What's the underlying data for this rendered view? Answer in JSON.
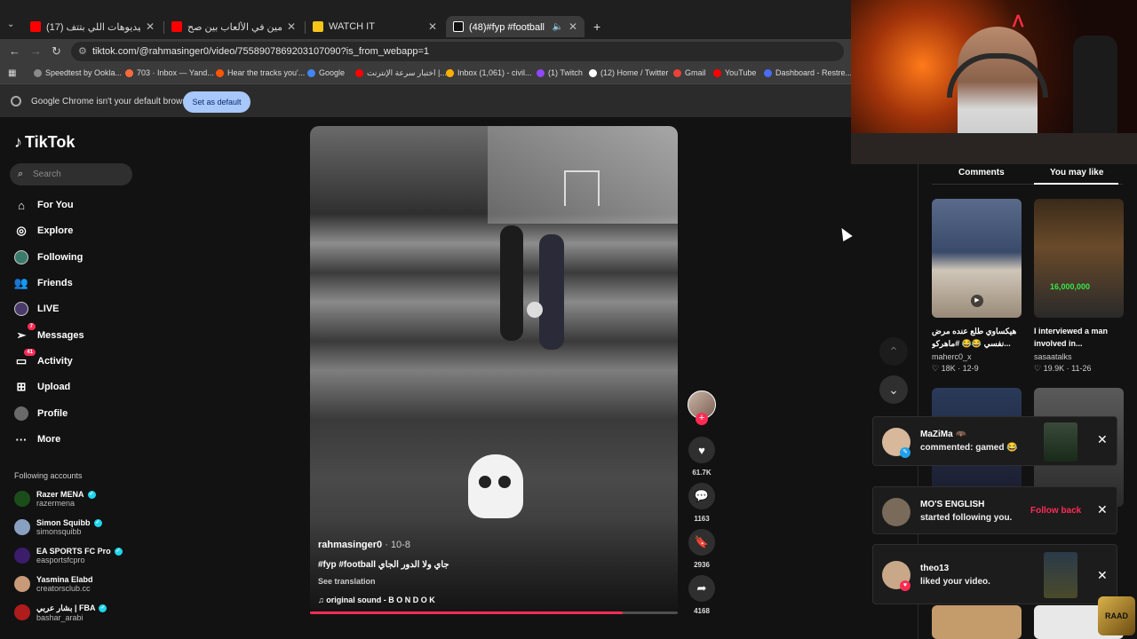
{
  "browser": {
    "tabs": [
      {
        "title": "(17) هي دي الفيديوهات اللي بتتف...",
        "icon": "youtube-icon",
        "color": "#ff0000",
        "active": false
      },
      {
        "title": "تحدي التخمين في الألعاب بين صح...",
        "icon": "youtube-icon",
        "color": "#ff0000",
        "active": false
      },
      {
        "title": "WATCH IT",
        "icon": "watchit-icon",
        "color": "#f5c518",
        "active": false
      },
      {
        "title": "(48)#fyp #football جاي ولا الدور الجاي",
        "icon": "tiktok-icon",
        "color": "#ffffff",
        "active": true
      }
    ],
    "new_tab": "+",
    "url": "tiktok.com/@rahmasinger0/video/7558907869203107090?is_from_webapp=1",
    "bookmarks": [
      {
        "label": "Speedtest by Ookla...",
        "color": "#8a8a8a"
      },
      {
        "label": "703 · Inbox — Yand...",
        "color": "#ff6a3d"
      },
      {
        "label": "Hear the tracks you'...",
        "color": "#ff5500"
      },
      {
        "label": "Google",
        "color": "#4285f4"
      },
      {
        "label": "اختبار سرعة الإنترنت |...",
        "color": "#ff0000"
      },
      {
        "label": "Inbox (1,061) - civil...",
        "color": "#ffb000"
      },
      {
        "label": "(1) Twitch",
        "color": "#9146ff"
      },
      {
        "label": "(12) Home / Twitter",
        "color": "#ffffff"
      },
      {
        "label": "Gmail",
        "color": "#ea4335"
      },
      {
        "label": "YouTube",
        "color": "#ff0000"
      },
      {
        "label": "Dashboard - Restre...",
        "color": "#4a6cf7"
      }
    ],
    "infobar": {
      "message": "Google Chrome isn't your default browser",
      "button": "Set as default"
    }
  },
  "tiktok": {
    "logo": "TikTok",
    "search_placeholder": "Search",
    "nav": [
      {
        "label": "For You",
        "icon": "home-icon"
      },
      {
        "label": "Explore",
        "icon": "compass-icon"
      },
      {
        "label": "Following",
        "icon": "following-avatar-icon"
      },
      {
        "label": "Friends",
        "icon": "friends-icon"
      },
      {
        "label": "LIVE",
        "icon": "live-icon"
      },
      {
        "label": "Messages",
        "icon": "messages-icon",
        "badge": "7"
      },
      {
        "label": "Activity",
        "icon": "activity-icon",
        "badge": "41"
      },
      {
        "label": "Upload",
        "icon": "upload-icon"
      },
      {
        "label": "Profile",
        "icon": "profile-avatar-icon"
      },
      {
        "label": "More",
        "icon": "more-icon"
      }
    ],
    "following_header": "Following accounts",
    "following": [
      {
        "name": "Razer MENA",
        "handle": "razermena",
        "verified": true,
        "color": "#1b4d1b"
      },
      {
        "name": "Simon Squibb",
        "handle": "simonsquibb",
        "verified": true,
        "color": "#8aa0c0"
      },
      {
        "name": "EA SPORTS FC Pro",
        "handle": "easportsfcpro",
        "verified": true,
        "color": "#3b1d6b"
      },
      {
        "name": "Yasmina Elabd",
        "handle": "creatorsclub.cc",
        "verified": false,
        "color": "#c89a7a"
      },
      {
        "name": "بشار عربي | FBA",
        "handle": "bashar_arabi",
        "verified": true,
        "color": "#b01c1c"
      }
    ],
    "video": {
      "author": "rahmasinger0",
      "date": "· 10-8",
      "caption": "#fyp #football جاي ولا الدور الجاي",
      "see_translation": "See translation",
      "sound": "original sound - B O N D O K",
      "progress": 0.85
    },
    "actions": {
      "likes": "61.7K",
      "comments": "1163",
      "saves": "2936",
      "shares": "4168"
    },
    "panel": {
      "tab_comments": "Comments",
      "tab_like": "You may like",
      "cards": [
        {
          "title": "هيكساوي طلع عنده مرض نفسي 😂😂 #ماهركو...",
          "user": "maherc0_x",
          "likes": "18K",
          "date": "12-9"
        },
        {
          "title": "I interviewed a man involved in...",
          "user": "sasaatalks",
          "likes": "19.9K",
          "date": "11-26",
          "overlay": "16,000,000"
        }
      ]
    },
    "notifications": [
      {
        "name": "MaZiMa 🦇",
        "text": "commented: gamed 😂",
        "type": "comment"
      },
      {
        "name": "MO'S ENGLISH",
        "text": "started following you.",
        "type": "follow",
        "action": "Follow back"
      },
      {
        "name": "theo13",
        "text": "liked your video.",
        "type": "like"
      }
    ]
  },
  "overlay": {
    "watermark": "RAAD"
  }
}
